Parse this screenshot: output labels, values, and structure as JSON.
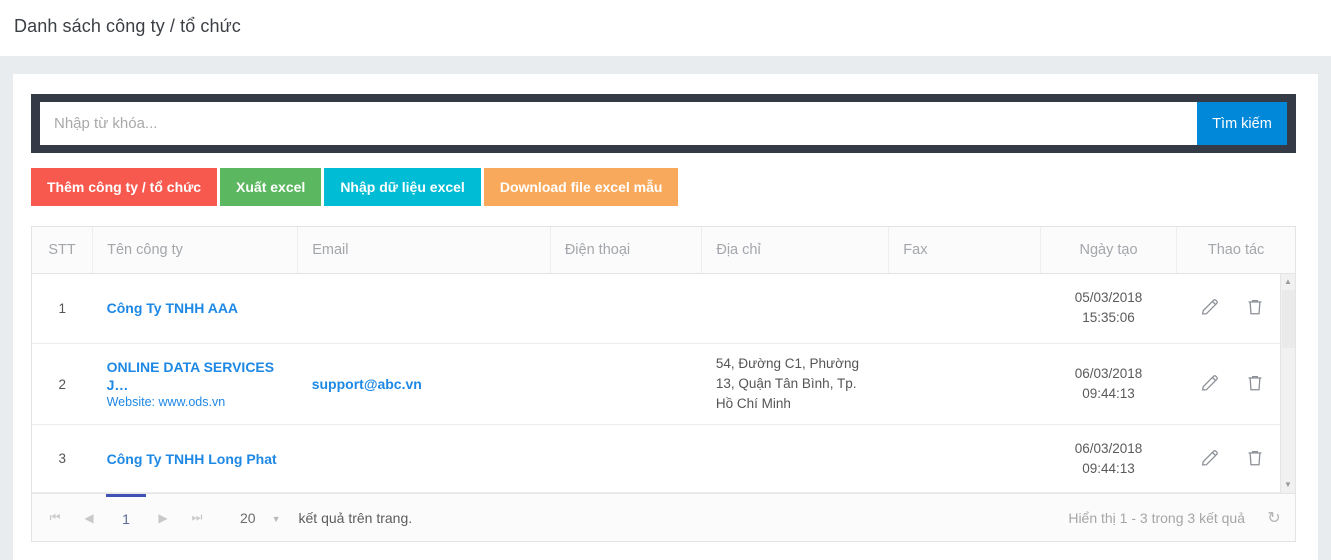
{
  "page": {
    "title": "Danh sách công ty / tổ chức"
  },
  "search": {
    "placeholder": "Nhập từ khóa...",
    "value": "",
    "button_label": "Tìm kiếm"
  },
  "actions": [
    {
      "label": "Thêm công ty / tổ chức",
      "color": "#f8594e",
      "name": "add-company-button"
    },
    {
      "label": "Xuất excel",
      "color": "#5cb860",
      "name": "export-excel-button"
    },
    {
      "label": "Nhập dữ liệu excel",
      "color": "#00bcd4",
      "name": "import-excel-button"
    },
    {
      "label": "Download file excel mẫu",
      "color": "#f9a95b",
      "name": "download-template-button"
    }
  ],
  "table": {
    "columns": [
      {
        "key": "stt",
        "label": "STT"
      },
      {
        "key": "name",
        "label": "Tên công ty"
      },
      {
        "key": "email",
        "label": "Email"
      },
      {
        "key": "phone",
        "label": "Điện thoại"
      },
      {
        "key": "address",
        "label": "Địa chỉ"
      },
      {
        "key": "fax",
        "label": "Fax"
      },
      {
        "key": "created",
        "label": "Ngày tạo"
      },
      {
        "key": "actions",
        "label": "Thao tác"
      }
    ],
    "rows": [
      {
        "stt": "1",
        "name": "Công Ty TNHH AAA",
        "website": "",
        "email": "",
        "phone": "",
        "address": "",
        "fax": "",
        "created_date": "05/03/2018",
        "created_time": "15:35:06"
      },
      {
        "stt": "2",
        "name": "ONLINE DATA SERVICES J…",
        "website": "Website: www.ods.vn",
        "email": "support@abc.vn",
        "phone": "",
        "address": "54, Đường C1, Phường 13, Quận Tân Bình, Tp. Hồ Chí Minh",
        "fax": "",
        "created_date": "06/03/2018",
        "created_time": "09:44:13"
      },
      {
        "stt": "3",
        "name": "Công Ty TNHH Long Phat",
        "website": "",
        "email": "",
        "phone": "",
        "address": "",
        "fax": "",
        "created_date": "06/03/2018",
        "created_time": "09:44:13"
      }
    ],
    "row_action_icons": [
      {
        "name": "edit-icon",
        "glyph": "pencil"
      },
      {
        "name": "delete-icon",
        "glyph": "trash"
      }
    ]
  },
  "pager": {
    "first_label": "⏮",
    "prev_label": "◀",
    "current_page": "1",
    "next_label": "▶",
    "last_label": "⏭",
    "page_size": "20",
    "page_size_caret": "▼",
    "per_page_label": "kết quả trên trang.",
    "info": "Hiển thị 1 - 3 trong 3 kết quả",
    "refresh_icon": "↻"
  },
  "scrollbar": {
    "up_arrow": "▲",
    "down_arrow": "▼"
  },
  "colors": {
    "accent_blue": "#1e88e5",
    "search_button": "#0288d9",
    "dark_bar": "#343b46",
    "page_background": "#e8ecef",
    "pager_active": "#3f51b5"
  }
}
